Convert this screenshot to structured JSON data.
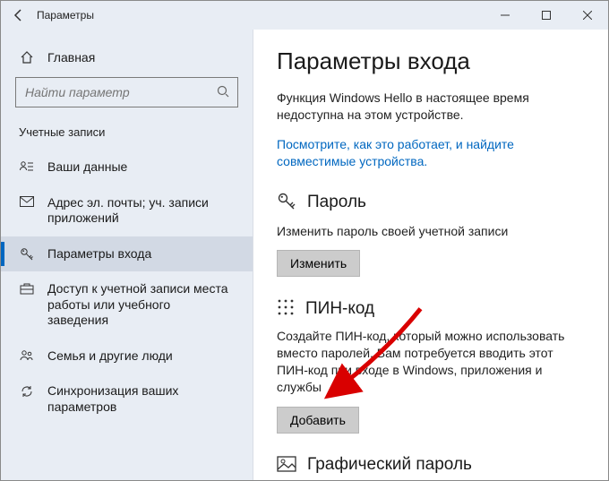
{
  "titlebar": {
    "title": "Параметры"
  },
  "sidebar": {
    "home": "Главная",
    "search_placeholder": "Найти параметр",
    "section": "Учетные записи",
    "items": [
      {
        "label": "Ваши данные"
      },
      {
        "label": "Адрес эл. почты; уч. записи приложений"
      },
      {
        "label": "Параметры входа"
      },
      {
        "label": "Доступ к учетной записи места работы или учебного заведения"
      },
      {
        "label": "Семья и другие люди"
      },
      {
        "label": "Синхронизация ваших параметров"
      }
    ]
  },
  "main": {
    "heading": "Параметры входа",
    "hello_text": "Функция Windows Hello в настоящее время недоступна на этом устройстве.",
    "hello_link": "Посмотрите, как это работает, и найдите совместимые устройства.",
    "password": {
      "title": "Пароль",
      "desc": "Изменить пароль своей учетной записи",
      "button": "Изменить"
    },
    "pin": {
      "title": "ПИН-код",
      "desc": "Создайте ПИН-код, который можно использовать вместо паролей. Вам потребуется вводить этот ПИН-код при входе в Windows, приложения и службы",
      "button": "Добавить"
    },
    "picture": {
      "title": "Графический пароль"
    }
  }
}
